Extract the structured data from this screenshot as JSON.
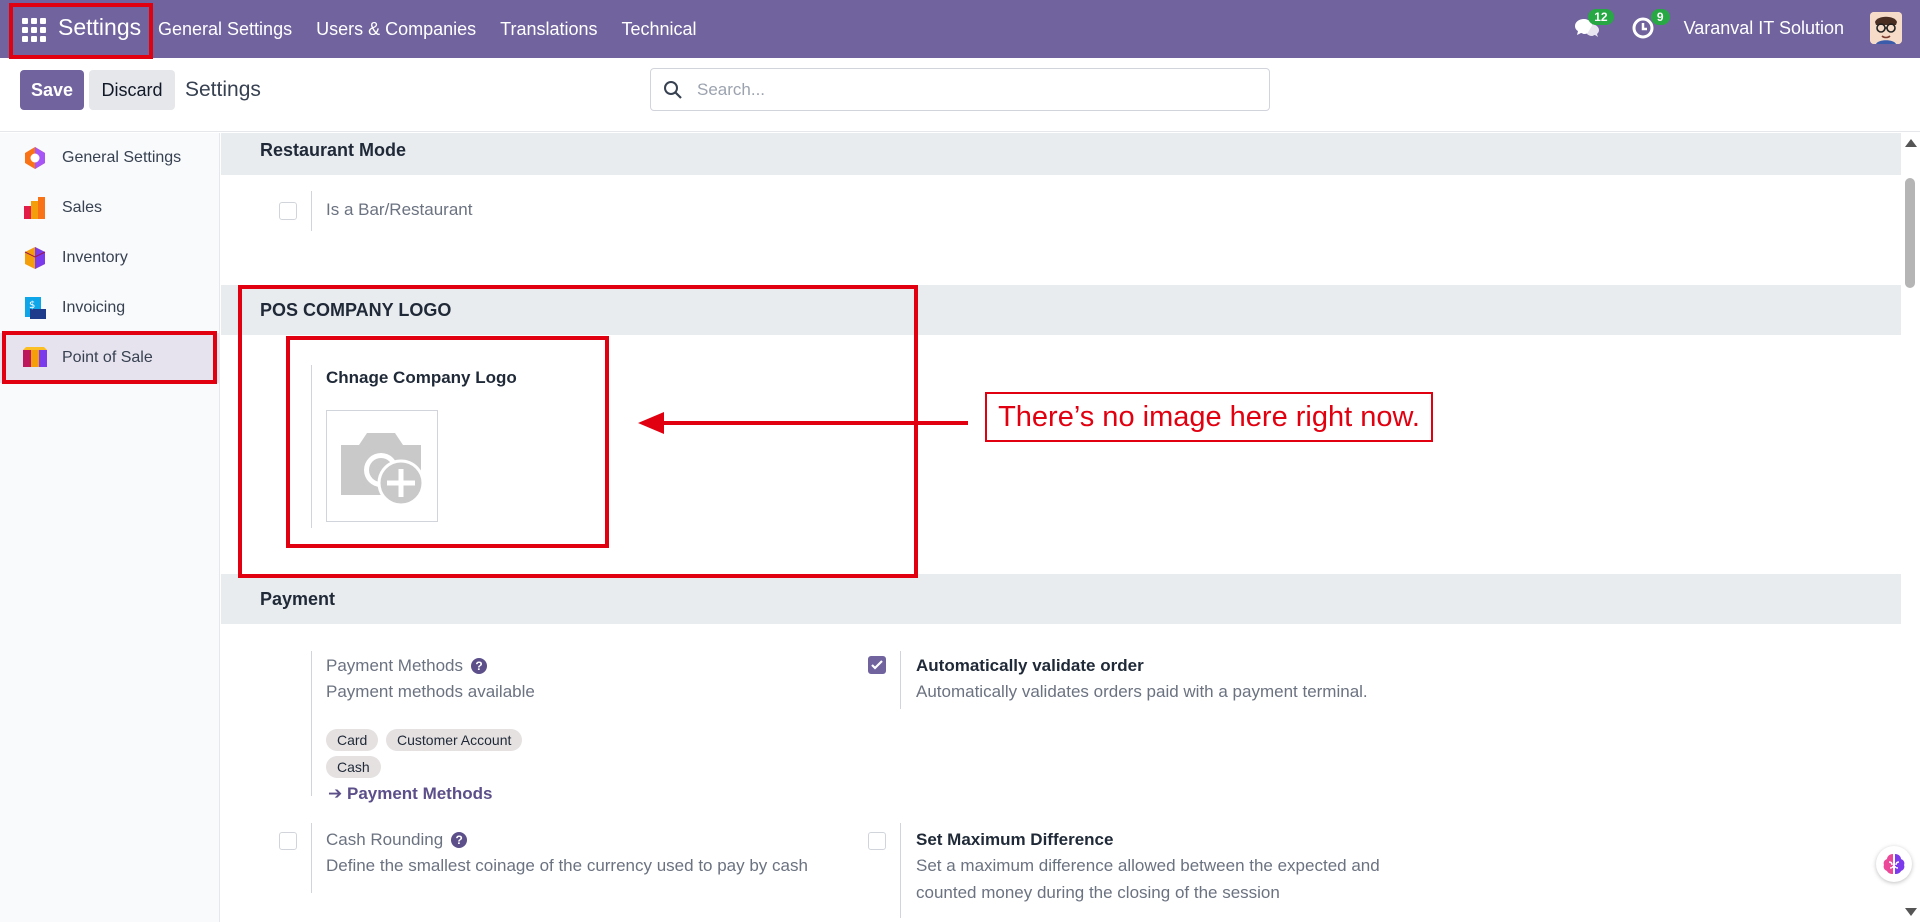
{
  "navbar": {
    "app_title": "Settings",
    "menu": [
      "General Settings",
      "Users & Companies",
      "Translations",
      "Technical"
    ],
    "messages_count": "12",
    "activities_count": "9",
    "company_name": "Varanval IT Solution"
  },
  "control": {
    "save_label": "Save",
    "discard_label": "Discard",
    "breadcrumb": "Settings",
    "search_placeholder": "Search..."
  },
  "sidebar": {
    "items": [
      {
        "label": "General Settings",
        "icon": "general-settings-icon"
      },
      {
        "label": "Sales",
        "icon": "sales-icon"
      },
      {
        "label": "Inventory",
        "icon": "inventory-icon"
      },
      {
        "label": "Invoicing",
        "icon": "invoicing-icon"
      },
      {
        "label": "Point of Sale",
        "icon": "point-of-sale-icon",
        "active": true
      }
    ]
  },
  "sections": {
    "restaurant": {
      "title": "Restaurant Mode",
      "bar_label": "Is a Bar/Restaurant",
      "bar_checked": false
    },
    "logo": {
      "title": "POS COMPANY LOGO",
      "field_label": "Chnage Company Logo"
    },
    "payment": {
      "title": "Payment",
      "methods_label": "Payment Methods",
      "methods_desc": "Payment methods available",
      "tags": [
        "Card",
        "Customer Account",
        "Cash"
      ],
      "methods_link": "Payment Methods",
      "auto_validate_label": "Automatically validate order",
      "auto_validate_desc": "Automatically validates orders paid with a payment terminal.",
      "auto_validate_checked": true,
      "cash_rounding_label": "Cash Rounding",
      "cash_rounding_desc": "Define the smallest coinage of the currency used to pay by cash",
      "max_diff_label": "Set Maximum Difference",
      "max_diff_desc_1": "Set a maximum difference allowed between the expected and",
      "max_diff_desc_2": "counted money during the closing of the session"
    }
  },
  "annotation": {
    "callout_text": "There’s no image here right now."
  },
  "colors": {
    "brand": "#71639e",
    "annotation_red": "#e10010",
    "badge_green": "#28a745"
  }
}
